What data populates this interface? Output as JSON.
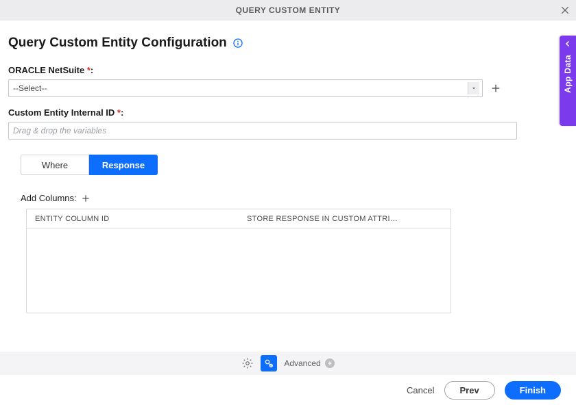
{
  "title_bar": {
    "title": "QUERY CUSTOM ENTITY"
  },
  "page": {
    "heading": "Query Custom Entity Configuration"
  },
  "fields": {
    "connection": {
      "label": "ORACLE NetSuite ",
      "required_marker": "*",
      "colon": ":",
      "selected": "--Select--"
    },
    "internal_id": {
      "label": "Custom Entity Internal ID ",
      "required_marker": "*",
      "colon": ":",
      "placeholder": "Drag & drop the variables"
    }
  },
  "tabs": {
    "where": "Where",
    "response": "Response",
    "active": "response"
  },
  "columns_panel": {
    "add_label": "Add Columns:",
    "headers": {
      "col1": "ENTITY COLUMN ID",
      "col2": "STORE RESPONSE IN CUSTOM ATTRI…"
    }
  },
  "side_tab": {
    "label": "App Data"
  },
  "footer": {
    "advanced_label": "Advanced",
    "cancel": "Cancel",
    "prev": "Prev",
    "finish": "Finish"
  },
  "colors": {
    "primary": "#0d6efd",
    "accent": "#7c3aed"
  }
}
